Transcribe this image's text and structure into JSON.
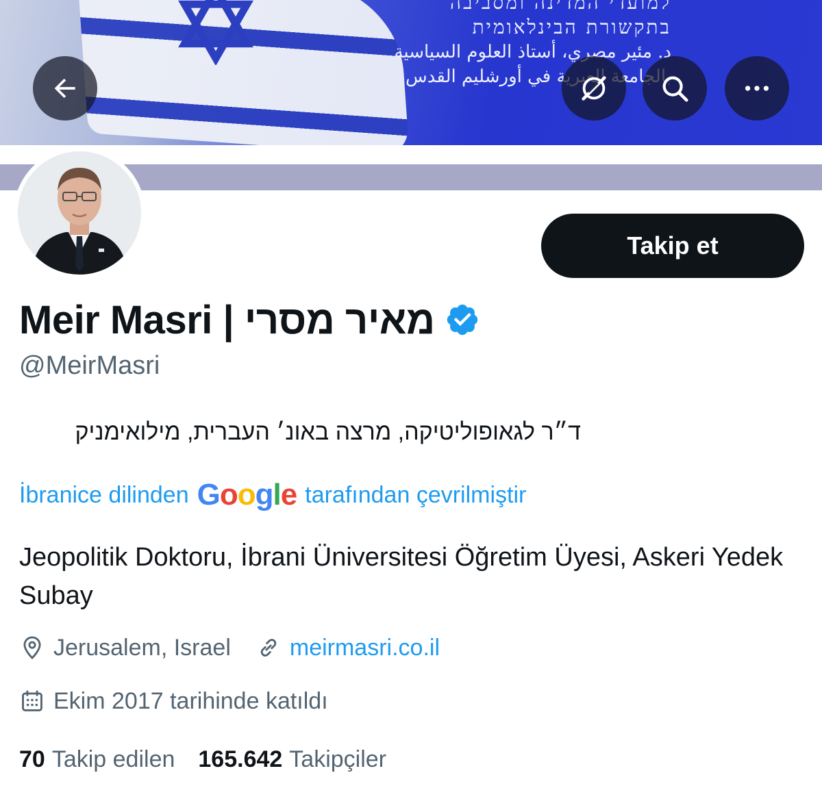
{
  "banner": {
    "hebrew_line1": "למועדי המדינה ומסביבה",
    "hebrew_line2": "בתקשורת הבינלאומית",
    "arabic_line1": "د. مئير مصري، أستاذ العلوم السياسية",
    "arabic_line2": "بالجامعة العبرية في أورشليم القدس"
  },
  "header": {
    "back_icon": "arrow-left-icon",
    "grok_icon": "grok-icon",
    "search_icon": "search-icon",
    "more_icon": "more-dots-icon"
  },
  "profile": {
    "display_name": "Meir Masri | מאיר מסרי",
    "handle": "@MeirMasri",
    "verified": true,
    "follow_label": "Takip et",
    "bio_original": "ד״ר לגאופוליטיקה, מרצה באונ׳ העברית, מילואימניק",
    "translation_prefix": "İbranice dilinden",
    "translation_provider": "Google",
    "translation_suffix": "tarafından çevrilmiştir",
    "bio_translated": "Jeopolitik Doktoru, İbrani Üniversitesi Öğretim Üyesi, Askeri Yedek Subay",
    "location": "Jerusalem, Israel",
    "website": "meirmasri.co.il",
    "joined": "Ekim 2017 tarihinde katıldı",
    "following_count": "70",
    "following_label": "Takip edilen",
    "followers_count": "165.642",
    "followers_label": "Takipçiler"
  },
  "colors": {
    "accent": "#1d9bf0",
    "text_primary": "#0f1419",
    "text_secondary": "#536471",
    "follow_button_bg": "#0f1419",
    "verified_badge": "#1d9bf0"
  }
}
